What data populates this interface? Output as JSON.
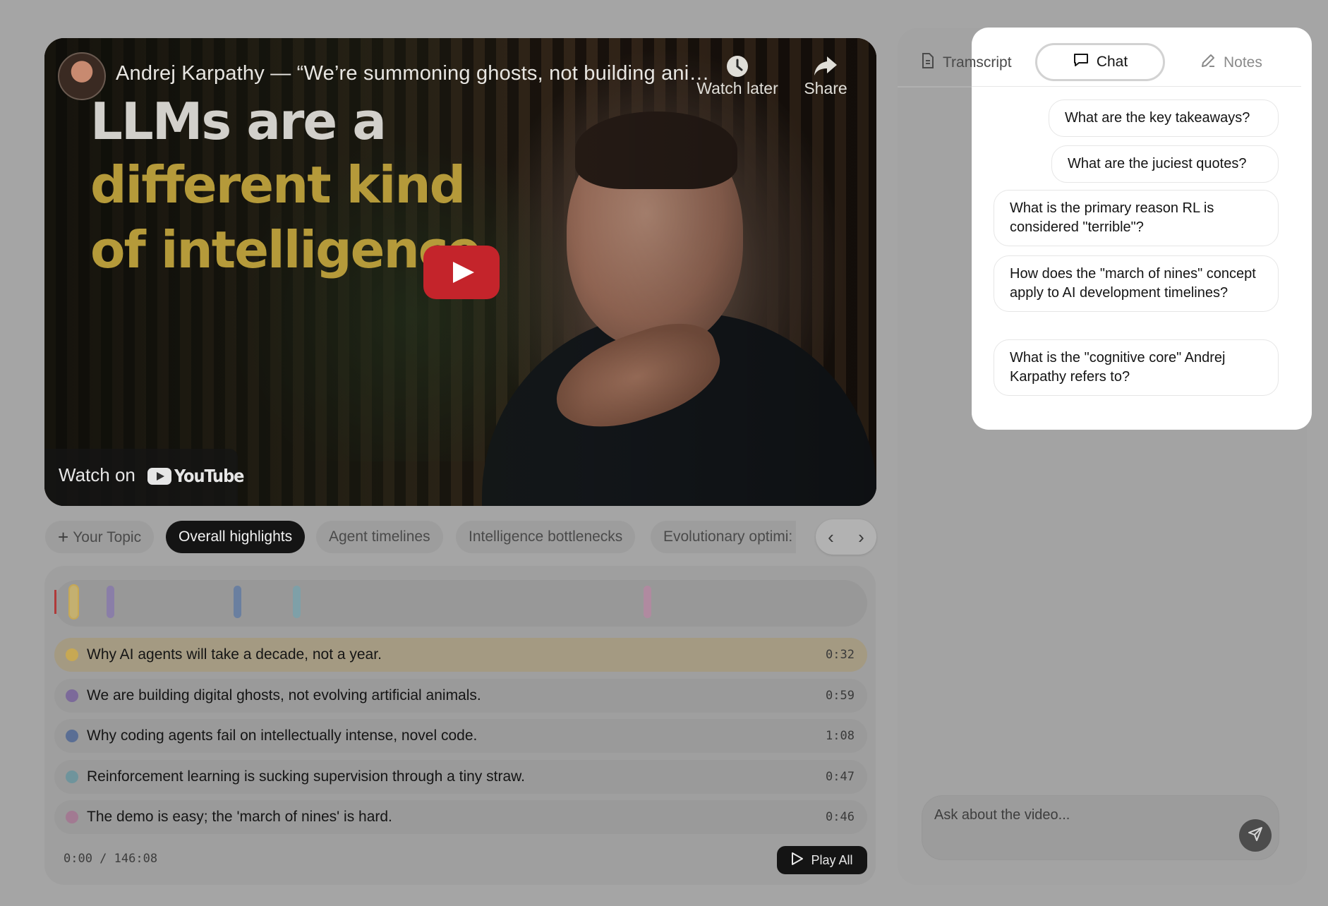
{
  "video": {
    "title": "Andrej Karpathy — “We’re summoning ghosts, not building ani…",
    "overlay_lines": [
      "LLMs are a",
      "different kind",
      "of intelligence"
    ],
    "watch_later_label": "Watch later",
    "share_label": "Share",
    "watch_on_label": "Watch on",
    "youtube_label": "YouTube"
  },
  "topics": {
    "add_label": "Your Topic",
    "items": [
      {
        "label": "Overall highlights",
        "active": true
      },
      {
        "label": "Agent timelines",
        "active": false
      },
      {
        "label": "Intelligence bottlenecks",
        "active": false
      },
      {
        "label": "Evolutionary optimi:",
        "active": false
      }
    ]
  },
  "timeline": {
    "marks": [
      {
        "position": 0.012,
        "color": "#c4b070"
      },
      {
        "position": 0.058,
        "color": "#8a7ea8"
      },
      {
        "position": 0.218,
        "color": "#6a7fa0"
      },
      {
        "position": 0.292,
        "color": "#7ea0a8"
      },
      {
        "position": 0.732,
        "color": "#b08aa0"
      }
    ]
  },
  "highlights": [
    {
      "text": "Why AI agents will take a decade, not a year.",
      "time": "0:32",
      "color": "#c7a853",
      "active": true
    },
    {
      "text": "We are building digital ghosts, not evolving artificial animals.",
      "time": "0:59",
      "color": "#7c6a9a",
      "active": false
    },
    {
      "text": "Why coding agents fail on intellectually intense, novel code.",
      "time": "1:08",
      "color": "#5a6e94",
      "active": false
    },
    {
      "text": "Reinforcement learning is sucking supervision through a tiny straw.",
      "time": "0:47",
      "color": "#6f949c",
      "active": false
    },
    {
      "text": "The demo is easy; the 'march of nines' is hard.",
      "time": "0:46",
      "color": "#a27a92",
      "active": false
    }
  ],
  "player": {
    "time_display": "0:00 / 146:08",
    "play_all_label": "Play All"
  },
  "sidebar": {
    "tabs": {
      "transcript": "Transcript",
      "chat": "Chat",
      "notes": "Notes"
    },
    "suggestions": [
      "What are the key takeaways?",
      "What are the juciest quotes?",
      "What is the primary reason RL is considered \"terrible\"?",
      "How does the \"march of nines\" concept apply to AI development timelines?",
      "What is the \"cognitive core\" Andrej Karpathy refers to?"
    ],
    "ask_placeholder": "Ask about the video..."
  }
}
